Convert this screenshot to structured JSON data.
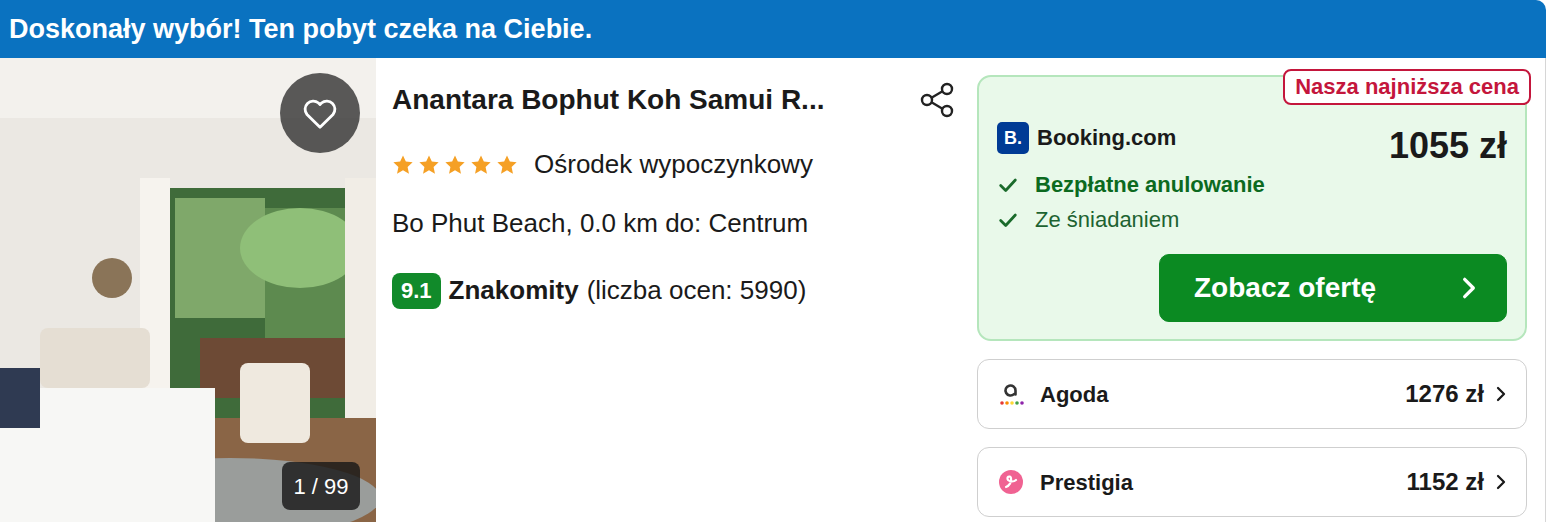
{
  "banner": "Doskonały wybór! Ten pobyt czeka na Ciebie.",
  "photo": {
    "counter": "1 / 99",
    "favorite": false
  },
  "hotel": {
    "name": "Anantara Bophut Koh Samui R...",
    "stars": 5,
    "type": "Ośrodek wypoczynkowy",
    "location": "Bo Phut Beach, 0.0 km do: Centrum",
    "rating": {
      "score": "9.1",
      "label": "Znakomity",
      "count": "(liczba ocen: 5990)"
    }
  },
  "best_offer": {
    "badge": "Nasza najniższa cena",
    "logo": "B.",
    "provider": "Booking.com",
    "price": "1055 zł",
    "features": [
      {
        "label": "Bezpłatne anulowanie"
      },
      {
        "label": "Ze śniadaniem"
      }
    ],
    "button": "Zobacz ofertę"
  },
  "other_offers": [
    {
      "provider": "Agoda",
      "price": "1276 zł"
    },
    {
      "provider": "Prestigia",
      "price": "1152 zł"
    }
  ]
}
